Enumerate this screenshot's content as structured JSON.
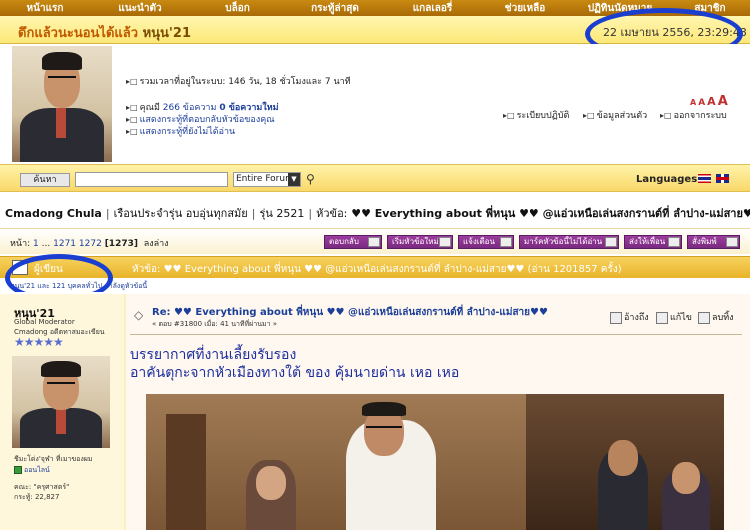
{
  "nav": {
    "items": [
      {
        "label": "หน้าแรก"
      },
      {
        "label": "แนะนำตัว"
      },
      {
        "label": "บล็อก"
      },
      {
        "label": "กระทู้ล่าสุด"
      },
      {
        "label": "แกลเลอรี่"
      },
      {
        "label": "ช่วยเหลือ"
      },
      {
        "label": "ปฏิทินนัดหมาย"
      },
      {
        "label": "สมาชิก"
      }
    ]
  },
  "welcome": {
    "greeting": "ดึกแล้วนะนอนได้แล้ว",
    "username": "หนุน'21",
    "datetime": "22 เมษายน 2556, 23:29:48"
  },
  "user_panel": {
    "total_time": "รวมเวลาที่อยู่ในระบบ: 146 วัน, 18 ชั่วโมงและ 7 นาที",
    "you_have_prefix": "คุณมี",
    "post_count": "266 ข้อความ",
    "new_messages": "0 ข้อความใหม่",
    "show_replies": "แสดงกระทู้ที่ตอบกลับหัวข้อของคุณ",
    "show_unread": "แสดงกระทู้ที่ยังไม่ได้อ่าน",
    "rules_link": "ระเบียบปฏิบัติ",
    "profile_link": "ข้อมูลส่วนตัว",
    "logout_link": "ออกจากระบบ",
    "font_sizes": [
      "A",
      "A",
      "A",
      "A"
    ]
  },
  "search": {
    "button_label": "ค้นหา",
    "input_value": "",
    "scope_value": "Entire Forum",
    "languages_label": "Languages"
  },
  "breadcrumb": {
    "board": "Cmadong Chula",
    "section": "เรือนประจำรุ่น อบอุ่นทุกสมัย",
    "class": "รุ่น 2521",
    "topic_prefix": "หัวข้อ:",
    "topic": "♥♥ Everything about พี่หนุน ♥♥ @แอ่วเหนือเล่นสงกรานต์ที่ ลำปาง-แม่สาย♥♥"
  },
  "pager": {
    "prefix": "หน้า:",
    "first": "1",
    "ellipsis": "...",
    "p1": "1271",
    "p2": "1272",
    "current": "[1273]",
    "go_down": "ลงล่าง"
  },
  "actions": [
    {
      "label": "ตอบกลับ"
    },
    {
      "label": "เริ่มหัวข้อใหม่"
    },
    {
      "label": "แจ้งเตือน"
    },
    {
      "label": "มาร์คหัวข้อนี้ไม่ได้อ่าน"
    },
    {
      "label": "ส่งให้เพื่อน"
    },
    {
      "label": "สั่งพิมพ์"
    }
  ],
  "topic_header": {
    "author_label": "ผู้เขียน",
    "topic_label": "หัวข้อ: ♥♥ Everything about พี่หนุน ♥♥ @แอ่วเหนือเล่นสงกรานต์ที่ ลำปาง-แม่สาย♥♥ (อ่าน 1201857 ครั้ง)",
    "readers": "หนุน'21 และ 121 บุคคลทั่วไป กำลังดูหัวข้อนี้"
  },
  "author": {
    "name": "หนุน'21",
    "title": "Global Moderator",
    "subtitle": "Cmadong อดีตทาสมอะเขียน",
    "stars": "★★★★★",
    "quote": "ชีมะโด่ง'จุฬา ที่เมาของผม",
    "online": "ออนไลน์",
    "group": "คณะ: \"ครุศาสตร์\"",
    "posts": "กระทู้: 22,827"
  },
  "post": {
    "title": "Re: ♥♥ Everything about พี่หนุน ♥♥ @แอ่วเหนือเล่นสงกรานต์ที่ ลำปาง-แม่สาย♥♥",
    "meta": "« ตอบ #31800 เมื่อ: 41 นาทีที่ผ่านมา »",
    "quote_action": "อ้างถึง",
    "edit_action": "แก้ไข",
    "delete_action": "ลบทิ้ง",
    "line1": "บรรยากาศที่งานเลี้ยงรับรอง",
    "line2": "อาคันตุกะจากหัวเมืองทางใต้ ของ คุ้มนายด่าน เหอ เหอ"
  },
  "colors": {
    "nav_bg": "#b87a0c",
    "header_yellow": "#fde878",
    "link_blue": "#1c3f9a",
    "action_purple": "#8a3390",
    "highlight_circle": "#1a3fd0"
  }
}
